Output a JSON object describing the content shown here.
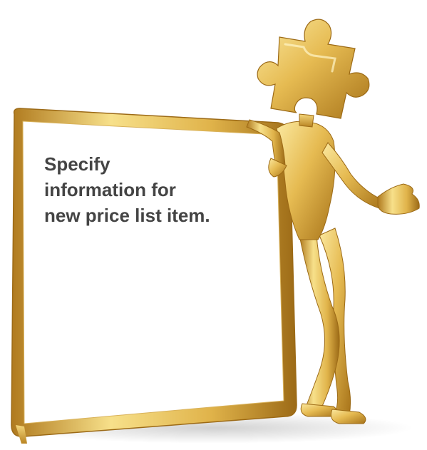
{
  "board": {
    "lines": [
      "Specify",
      "information for",
      "new price list item."
    ]
  },
  "colors": {
    "gold_light": "#f7e08a",
    "gold_mid": "#e0b34a",
    "gold_dark": "#a8741a",
    "board_fill": "#ffffff",
    "text": "#444444"
  },
  "icons": {
    "figure": "golden-puzzle-head-figure",
    "board": "blank-whiteboard"
  }
}
